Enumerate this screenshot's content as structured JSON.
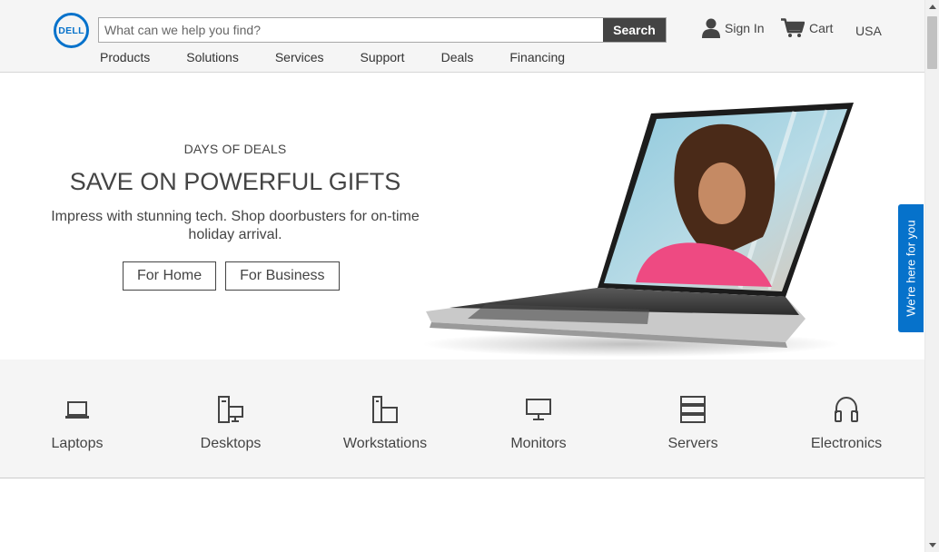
{
  "header": {
    "logo_text": "DELL",
    "search_placeholder": "What can we help you find?",
    "search_button": "Search",
    "signin_label": "Sign In",
    "cart_label": "Cart",
    "country_label": "USA",
    "nav": [
      "Products",
      "Solutions",
      "Services",
      "Support",
      "Deals",
      "Financing"
    ]
  },
  "hero": {
    "eyebrow": "DAYS OF DEALS",
    "title": "SAVE ON POWERFUL GIFTS",
    "subtitle": "Impress with stunning tech. Shop doorbusters for on-time holiday arrival.",
    "buttons": [
      "For Home",
      "For Business"
    ]
  },
  "side_tab": {
    "label": "We're here for you"
  },
  "categories": [
    {
      "label": "Laptops",
      "icon": "laptop-icon"
    },
    {
      "label": "Desktops",
      "icon": "desktop-icon"
    },
    {
      "label": "Workstations",
      "icon": "workstation-icon"
    },
    {
      "label": "Monitors",
      "icon": "monitor-icon"
    },
    {
      "label": "Servers",
      "icon": "server-icon"
    },
    {
      "label": "Electronics",
      "icon": "headphones-icon"
    }
  ],
  "colors": {
    "brand_blue": "#0672cb",
    "text": "#444444",
    "header_bg": "#f5f5f5"
  }
}
